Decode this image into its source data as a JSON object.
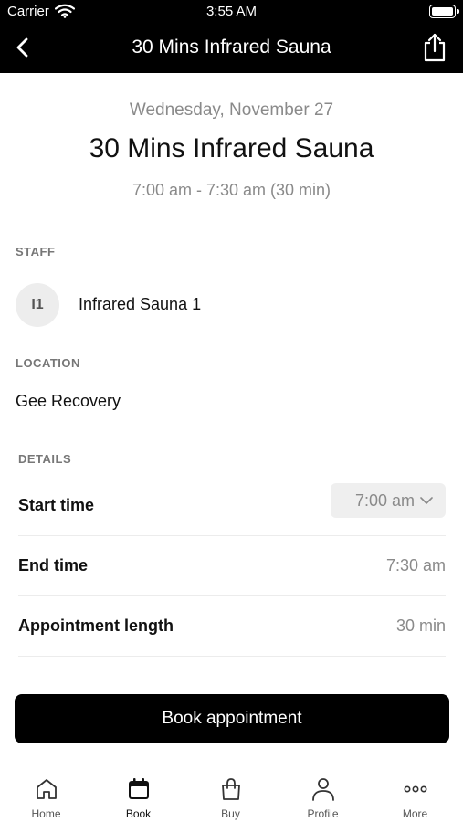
{
  "status_bar": {
    "carrier": "Carrier",
    "time": "3:55 AM"
  },
  "nav": {
    "title": "30 Mins Infrared Sauna",
    "back_icon": "chevron-left-icon",
    "share_icon": "share-icon"
  },
  "header": {
    "date": "Wednesday, November 27",
    "title": "30 Mins Infrared Sauna",
    "time_range": "7:00 am - 7:30 am (30 min)"
  },
  "staff": {
    "label": "STAFF",
    "initials": "I1",
    "name": "Infrared Sauna 1"
  },
  "location": {
    "label": "LOCATION",
    "name": "Gee Recovery"
  },
  "details": {
    "label": "DETAILS",
    "start_time": {
      "label": "Start time",
      "value": "7:00 am"
    },
    "end_time": {
      "label": "End time",
      "value": "7:30 am"
    },
    "length": {
      "label": "Appointment length",
      "value": "30 min"
    }
  },
  "book_button": "Book appointment",
  "tabs": [
    {
      "label": "Home",
      "icon": "home-icon"
    },
    {
      "label": "Book",
      "icon": "calendar-icon"
    },
    {
      "label": "Buy",
      "icon": "shopping-bag-icon"
    },
    {
      "label": "Profile",
      "icon": "person-icon"
    },
    {
      "label": "More",
      "icon": "more-dots-icon"
    }
  ],
  "colors": {
    "bar": "#000000",
    "muted_text": "#8a8a8a",
    "accent": "#000000"
  }
}
